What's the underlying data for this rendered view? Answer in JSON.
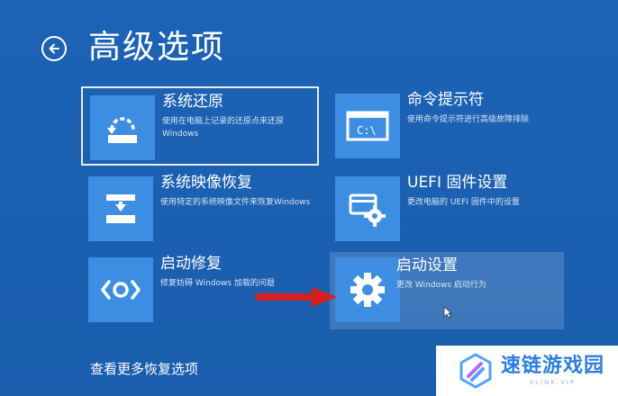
{
  "page": {
    "title": "高级选项"
  },
  "options": [
    {
      "title": "系统还原",
      "desc": "使用在电脑上记录的还原点来还原Windows",
      "icon": "system-restore-icon",
      "state": "selected"
    },
    {
      "title": "命令提示符",
      "desc": "使用命令提示符进行高级故障排除",
      "icon": "command-prompt-icon"
    },
    {
      "title": "系统映像恢复",
      "desc": "使用特定的系统映像文件来恢复Windows",
      "icon": "system-image-icon"
    },
    {
      "title": "UEFI 固件设置",
      "desc": "更改电脑的 UEFI 固件中的设置",
      "icon": "uefi-settings-icon"
    },
    {
      "title": "启动修复",
      "desc": "修复妨碍 Windows 加载的问题",
      "icon": "startup-repair-icon"
    },
    {
      "title": "启动设置",
      "desc": "更改 Windows 启动行为",
      "icon": "gear-icon",
      "state": "hover"
    }
  ],
  "footer": {
    "more_link": "查看更多恢复选项"
  },
  "watermark": {
    "brand": "速链游戏园",
    "sub": "SLINK.VIP"
  },
  "colors": {
    "background": "#1b5fb0",
    "tile": "#3d8ee3",
    "arrow": "#d81e1e",
    "watermark_text": "#2c7ee0"
  }
}
